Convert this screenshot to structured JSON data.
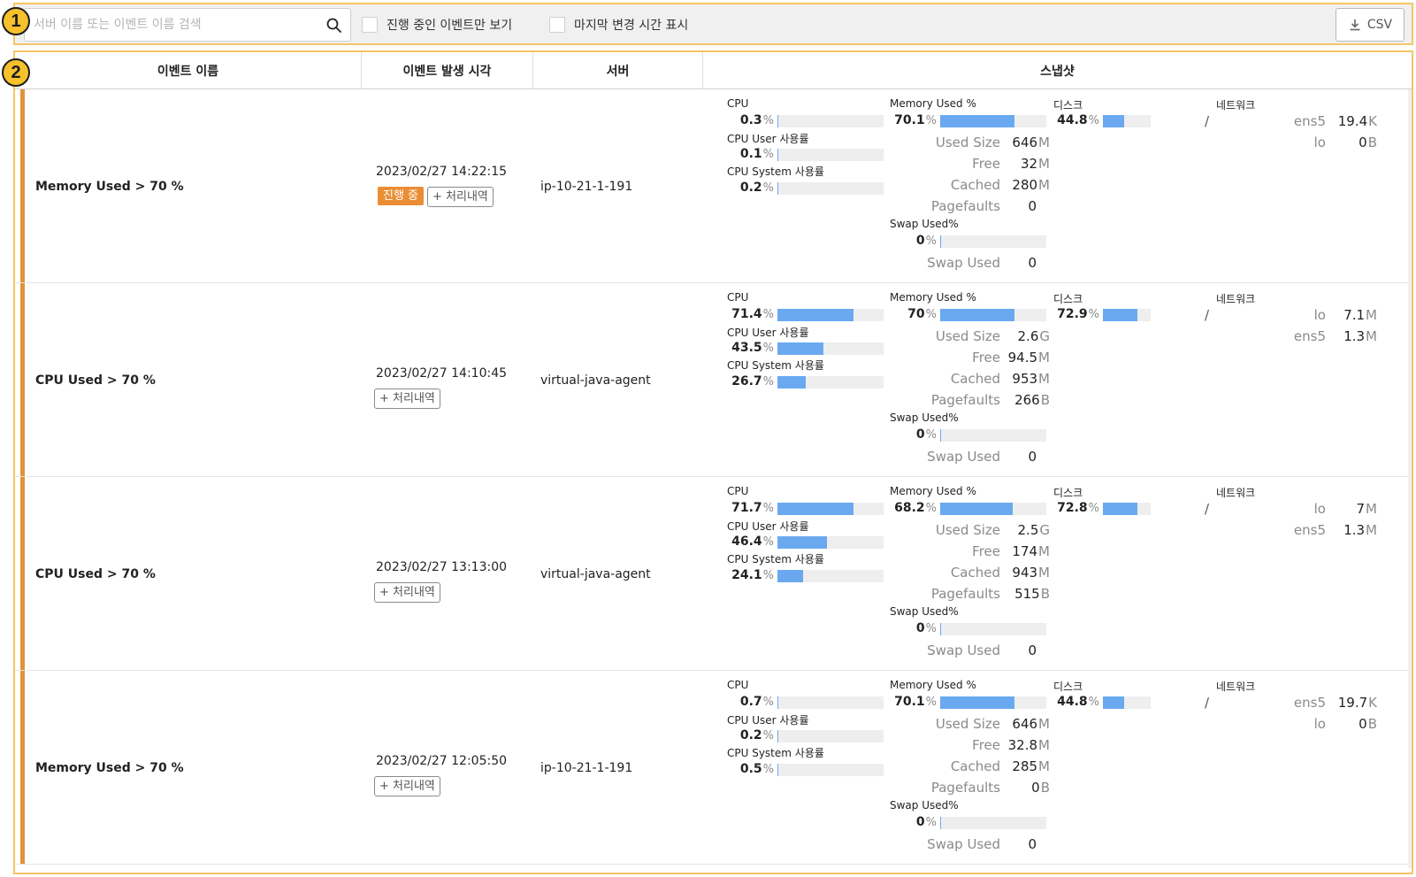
{
  "callouts": [
    "1",
    "2"
  ],
  "toolbar": {
    "search_placeholder": "서버 이름 또는 이벤트 이름 검색",
    "search_value": "",
    "only_ongoing_label": "진행 중인 이벤트만 보기",
    "only_ongoing_checked": false,
    "show_last_changed_label": "마지막 변경 시간 표시",
    "show_last_changed_checked": false,
    "csv_label": "CSV"
  },
  "columns": [
    "이벤트 이름",
    "이벤트 발생 시각",
    "서버",
    "스냅샷"
  ],
  "labels": {
    "cpu": "CPU",
    "cpu_user": "CPU User 사용률",
    "cpu_system": "CPU System 사용률",
    "memory_used": "Memory Used %",
    "used_size": "Used Size",
    "free": "Free",
    "cached": "Cached",
    "pagefaults": "Pagefaults",
    "swap_used_pct": "Swap Used%",
    "swap_used": "Swap Used",
    "disk": "디스크",
    "network": "네트워크",
    "percent_unit": "%",
    "ongoing_tag": "진행 중",
    "history_button": "+ 처리내역"
  },
  "colors": {
    "accent": "#e0943a",
    "ongoing_tag": "#ea8e35",
    "bar": "#6aa9f0",
    "callout": "#f6c12b"
  },
  "rows": [
    {
      "event_name": "Memory Used > 70 %",
      "time": "2023/02/27 14:22:15",
      "ongoing": true,
      "server": "ip-10-21-1-191",
      "cpu": "0.3",
      "cpu_pct": 0.3,
      "cpu_user": "0.1",
      "cpu_user_pct": 0.1,
      "cpu_system": "0.2",
      "cpu_system_pct": 0.2,
      "mem": "70.1",
      "mem_pct": 70.1,
      "used_size": "646",
      "used_size_unit": "M",
      "free": "32",
      "free_unit": "M",
      "cached": "280",
      "cached_unit": "M",
      "pagefaults": "0",
      "pagefaults_unit": "",
      "swap_pct_text": "0",
      "swap_pct": 0,
      "swap_used": "0",
      "disk": "44.8",
      "disk_pct": 44.8,
      "disk_mount": "/",
      "net": [
        {
          "name": "ens5",
          "value": "19.4",
          "unit": "K"
        },
        {
          "name": "lo",
          "value": "0",
          "unit": "B"
        }
      ]
    },
    {
      "event_name": "CPU Used > 70 %",
      "time": "2023/02/27 14:10:45",
      "ongoing": false,
      "server": "virtual-java-agent",
      "cpu": "71.4",
      "cpu_pct": 71.4,
      "cpu_user": "43.5",
      "cpu_user_pct": 43.5,
      "cpu_system": "26.7",
      "cpu_system_pct": 26.7,
      "mem": "70",
      "mem_pct": 70,
      "used_size": "2.6",
      "used_size_unit": "G",
      "free": "94.5",
      "free_unit": "M",
      "cached": "953",
      "cached_unit": "M",
      "pagefaults": "266",
      "pagefaults_unit": "B",
      "swap_pct_text": "0",
      "swap_pct": 0,
      "swap_used": "0",
      "disk": "72.9",
      "disk_pct": 72.9,
      "disk_mount": "/",
      "net": [
        {
          "name": "lo",
          "value": "7.1",
          "unit": "M"
        },
        {
          "name": "ens5",
          "value": "1.3",
          "unit": "M"
        }
      ]
    },
    {
      "event_name": "CPU Used > 70 %",
      "time": "2023/02/27 13:13:00",
      "ongoing": false,
      "server": "virtual-java-agent",
      "cpu": "71.7",
      "cpu_pct": 71.7,
      "cpu_user": "46.4",
      "cpu_user_pct": 46.4,
      "cpu_system": "24.1",
      "cpu_system_pct": 24.1,
      "mem": "68.2",
      "mem_pct": 68.2,
      "used_size": "2.5",
      "used_size_unit": "G",
      "free": "174",
      "free_unit": "M",
      "cached": "943",
      "cached_unit": "M",
      "pagefaults": "515",
      "pagefaults_unit": "B",
      "swap_pct_text": "0",
      "swap_pct": 0,
      "swap_used": "0",
      "disk": "72.8",
      "disk_pct": 72.8,
      "disk_mount": "/",
      "net": [
        {
          "name": "lo",
          "value": "7",
          "unit": "M"
        },
        {
          "name": "ens5",
          "value": "1.3",
          "unit": "M"
        }
      ]
    },
    {
      "event_name": "Memory Used > 70 %",
      "time": "2023/02/27 12:05:50",
      "ongoing": false,
      "server": "ip-10-21-1-191",
      "cpu": "0.7",
      "cpu_pct": 0.7,
      "cpu_user": "0.2",
      "cpu_user_pct": 0.2,
      "cpu_system": "0.5",
      "cpu_system_pct": 0.5,
      "mem": "70.1",
      "mem_pct": 70.1,
      "used_size": "646",
      "used_size_unit": "M",
      "free": "32.8",
      "free_unit": "M",
      "cached": "285",
      "cached_unit": "M",
      "pagefaults": "0",
      "pagefaults_unit": "B",
      "swap_pct_text": "0",
      "swap_pct": 0,
      "swap_used": "0",
      "disk": "44.8",
      "disk_pct": 44.8,
      "disk_mount": "/",
      "net": [
        {
          "name": "ens5",
          "value": "19.7",
          "unit": "K"
        },
        {
          "name": "lo",
          "value": "0",
          "unit": "B"
        }
      ]
    }
  ]
}
